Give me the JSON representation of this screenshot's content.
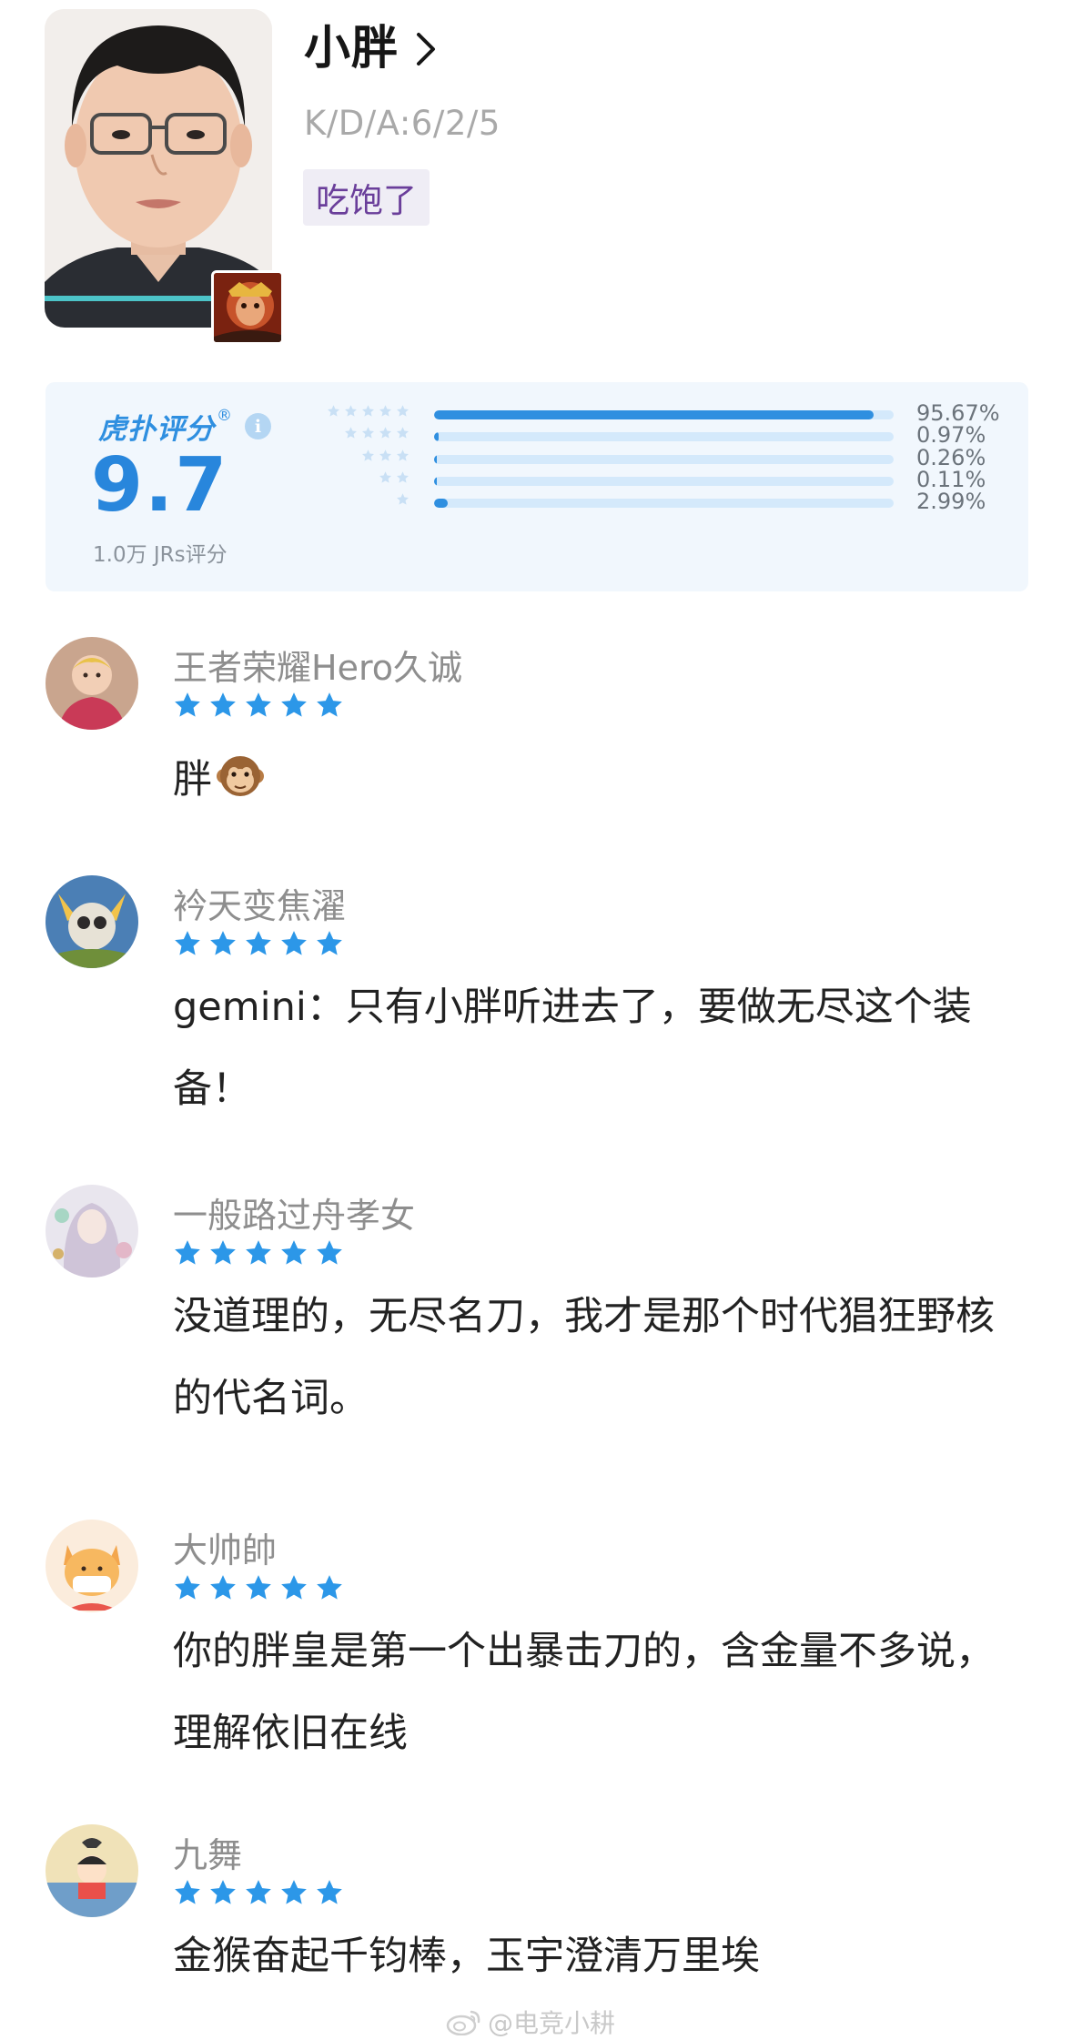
{
  "profile": {
    "name": "小胖",
    "kda": "K/D/A:6/2/5",
    "tag": "吃饱了"
  },
  "rating": {
    "brand": "虎扑评分",
    "brand_mark": "®",
    "info_icon": "i",
    "score": "9.7",
    "count_label": "1.0万 JRs评分",
    "distribution": [
      {
        "stars": 5,
        "percent": 95.67,
        "label": "95.67%"
      },
      {
        "stars": 4,
        "percent": 0.97,
        "label": "0.97%"
      },
      {
        "stars": 3,
        "percent": 0.26,
        "label": "0.26%"
      },
      {
        "stars": 2,
        "percent": 0.11,
        "label": "0.11%"
      },
      {
        "stars": 1,
        "percent": 2.99,
        "label": "2.99%"
      }
    ],
    "colors": {
      "accent": "#2f8fe0",
      "track": "#d4e9fb",
      "panel": "#f1f7fd"
    }
  },
  "comments": [
    {
      "author": "王者荣耀Hero久诚",
      "stars": 5,
      "text": "胖",
      "emoji": "monkey-face"
    },
    {
      "author": "衿天变焦濯",
      "stars": 5,
      "text": "gemini：只有小胖听进去了，要做无尽这个装备！"
    },
    {
      "author": "一般路过舟孝女",
      "stars": 5,
      "text": "没道理的，无尽名刀，我才是那个时代猖狂野核的代名词。"
    },
    {
      "author": "大帅帥",
      "stars": 5,
      "text": "你的胖皇是第一个出暴击刀的，含金量不多说，理解依旧在线"
    },
    {
      "author": "九舞",
      "stars": 5,
      "text": "金猴奋起千钧棒，玉宇澄清万里埃"
    }
  ],
  "watermark": "@电竞小耕",
  "icons": {
    "name_chevron": "chevron-right-icon",
    "star": "star-icon",
    "watermark_logo": "weibo-icon"
  }
}
